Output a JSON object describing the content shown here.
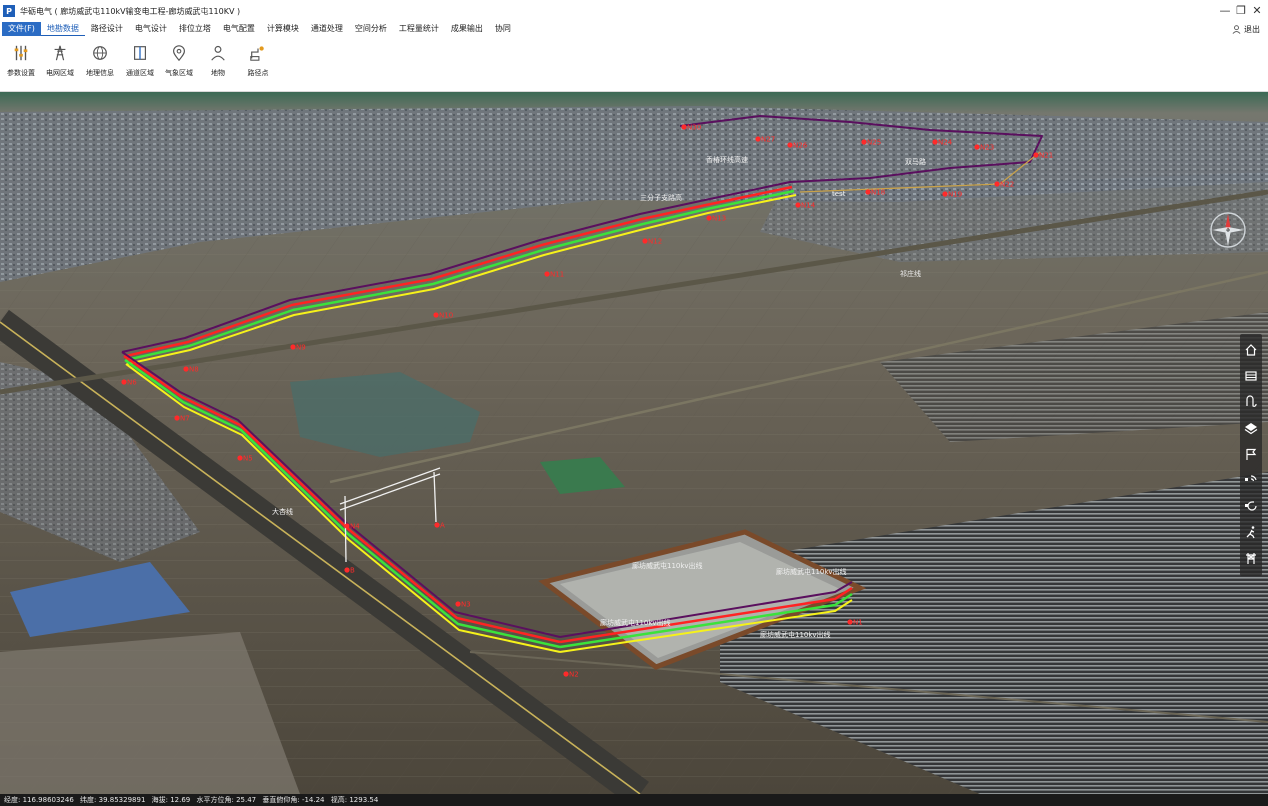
{
  "window": {
    "title": "华砺电气 ( 廊坊威武屯110kV输变电工程-廊坊威武屯110KV )",
    "logo_glyph": "P",
    "controls": {
      "minimize": "—",
      "maximize": "❐",
      "close": "✕"
    }
  },
  "menu": {
    "items": [
      "文件(F)",
      "地勘数据",
      "路径设计",
      "电气设计",
      "排位立塔",
      "电气配置",
      "计算模块",
      "通道处理",
      "空间分析",
      "工程量统计",
      "成果输出",
      "协同"
    ],
    "active_index": 1
  },
  "user": {
    "logout_label": "退出"
  },
  "ribbon": {
    "buttons": [
      {
        "label": "参数设置",
        "icon": "sliders-icon"
      },
      {
        "label": "电网区域",
        "icon": "tower-icon"
      },
      {
        "label": "地理信息",
        "icon": "globe-icon"
      },
      {
        "label": "通道区域",
        "icon": "channel-icon"
      },
      {
        "label": "气象区域",
        "icon": "location-pin-icon"
      },
      {
        "label": "地物",
        "icon": "person-icon"
      },
      {
        "label": "路径点",
        "icon": "route-point-icon"
      }
    ]
  },
  "map": {
    "labels": [
      "香椿环线高速",
      "双马路",
      "三分子支路高",
      "test",
      "祁庄线",
      "大杏线",
      "廊坊威武屯110kv出线",
      "廊坊威武屯110kv出线",
      "廊坊威武屯110kv出线",
      "廊坊威武屯110kv出线"
    ],
    "point_labels": [
      "N30",
      "N27",
      "N26",
      "N25",
      "N24",
      "N23",
      "N21",
      "N22",
      "N19",
      "N18",
      "N14",
      "N13",
      "N12",
      "N11",
      "N10",
      "N9",
      "N8",
      "N7",
      "N6",
      "N5",
      "N4",
      "N3",
      "N2",
      "N1",
      "A",
      "B"
    ],
    "colors": {
      "route_yellow": "#f6f21a",
      "route_green": "#3be23b",
      "route_red": "#ff2323",
      "route_purple": "#5a0f5e",
      "point_red": "#ff2a2a"
    }
  },
  "right_toolbar": [
    "home-icon",
    "ruler-icon",
    "measure-icon",
    "layers-icon",
    "flag-icon",
    "wifi-icon",
    "rotate-icon",
    "walk-icon",
    "tower-icon"
  ],
  "status": {
    "longitude": "经度: 116.98603246",
    "latitude": "纬度: 39.85329891",
    "altitude": "海拔: 12.69",
    "heading": "水平方位角: 25.47",
    "pitch": "垂直俯仰角: -14.24",
    "view_height": "视高: 1293.54"
  }
}
